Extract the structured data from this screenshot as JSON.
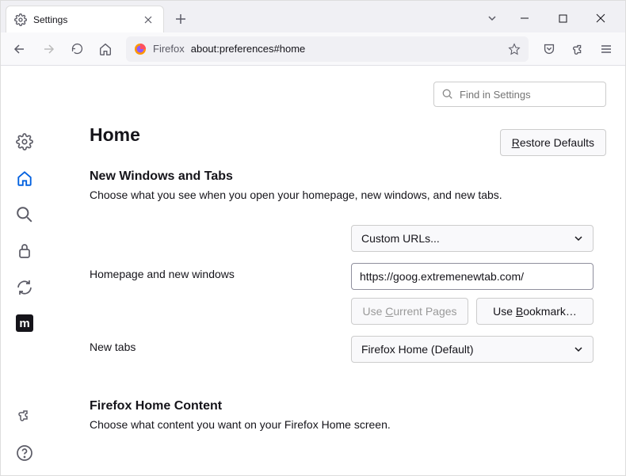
{
  "tab": {
    "title": "Settings"
  },
  "url": {
    "proto": "Firefox",
    "rest": "about:preferences#home"
  },
  "search": {
    "placeholder": "Find in Settings"
  },
  "page": {
    "title": "Home",
    "restore": "Restore Defaults",
    "restore_key": "R"
  },
  "section1": {
    "title": "New Windows and Tabs",
    "desc": "Choose what you see when you open your homepage, new windows, and new tabs."
  },
  "homepage": {
    "label": "Homepage and new windows",
    "select": "Custom URLs...",
    "url": "https://goog.extremenewtab.com/",
    "use_current": "Use Current Pages",
    "use_current_key": "C",
    "use_bookmark": "Use Bookmark…",
    "use_bookmark_key": "B"
  },
  "newtabs": {
    "label": "New tabs",
    "select": "Firefox Home (Default)"
  },
  "section2": {
    "title": "Firefox Home Content",
    "desc": "Choose what content you want on your Firefox Home screen."
  }
}
